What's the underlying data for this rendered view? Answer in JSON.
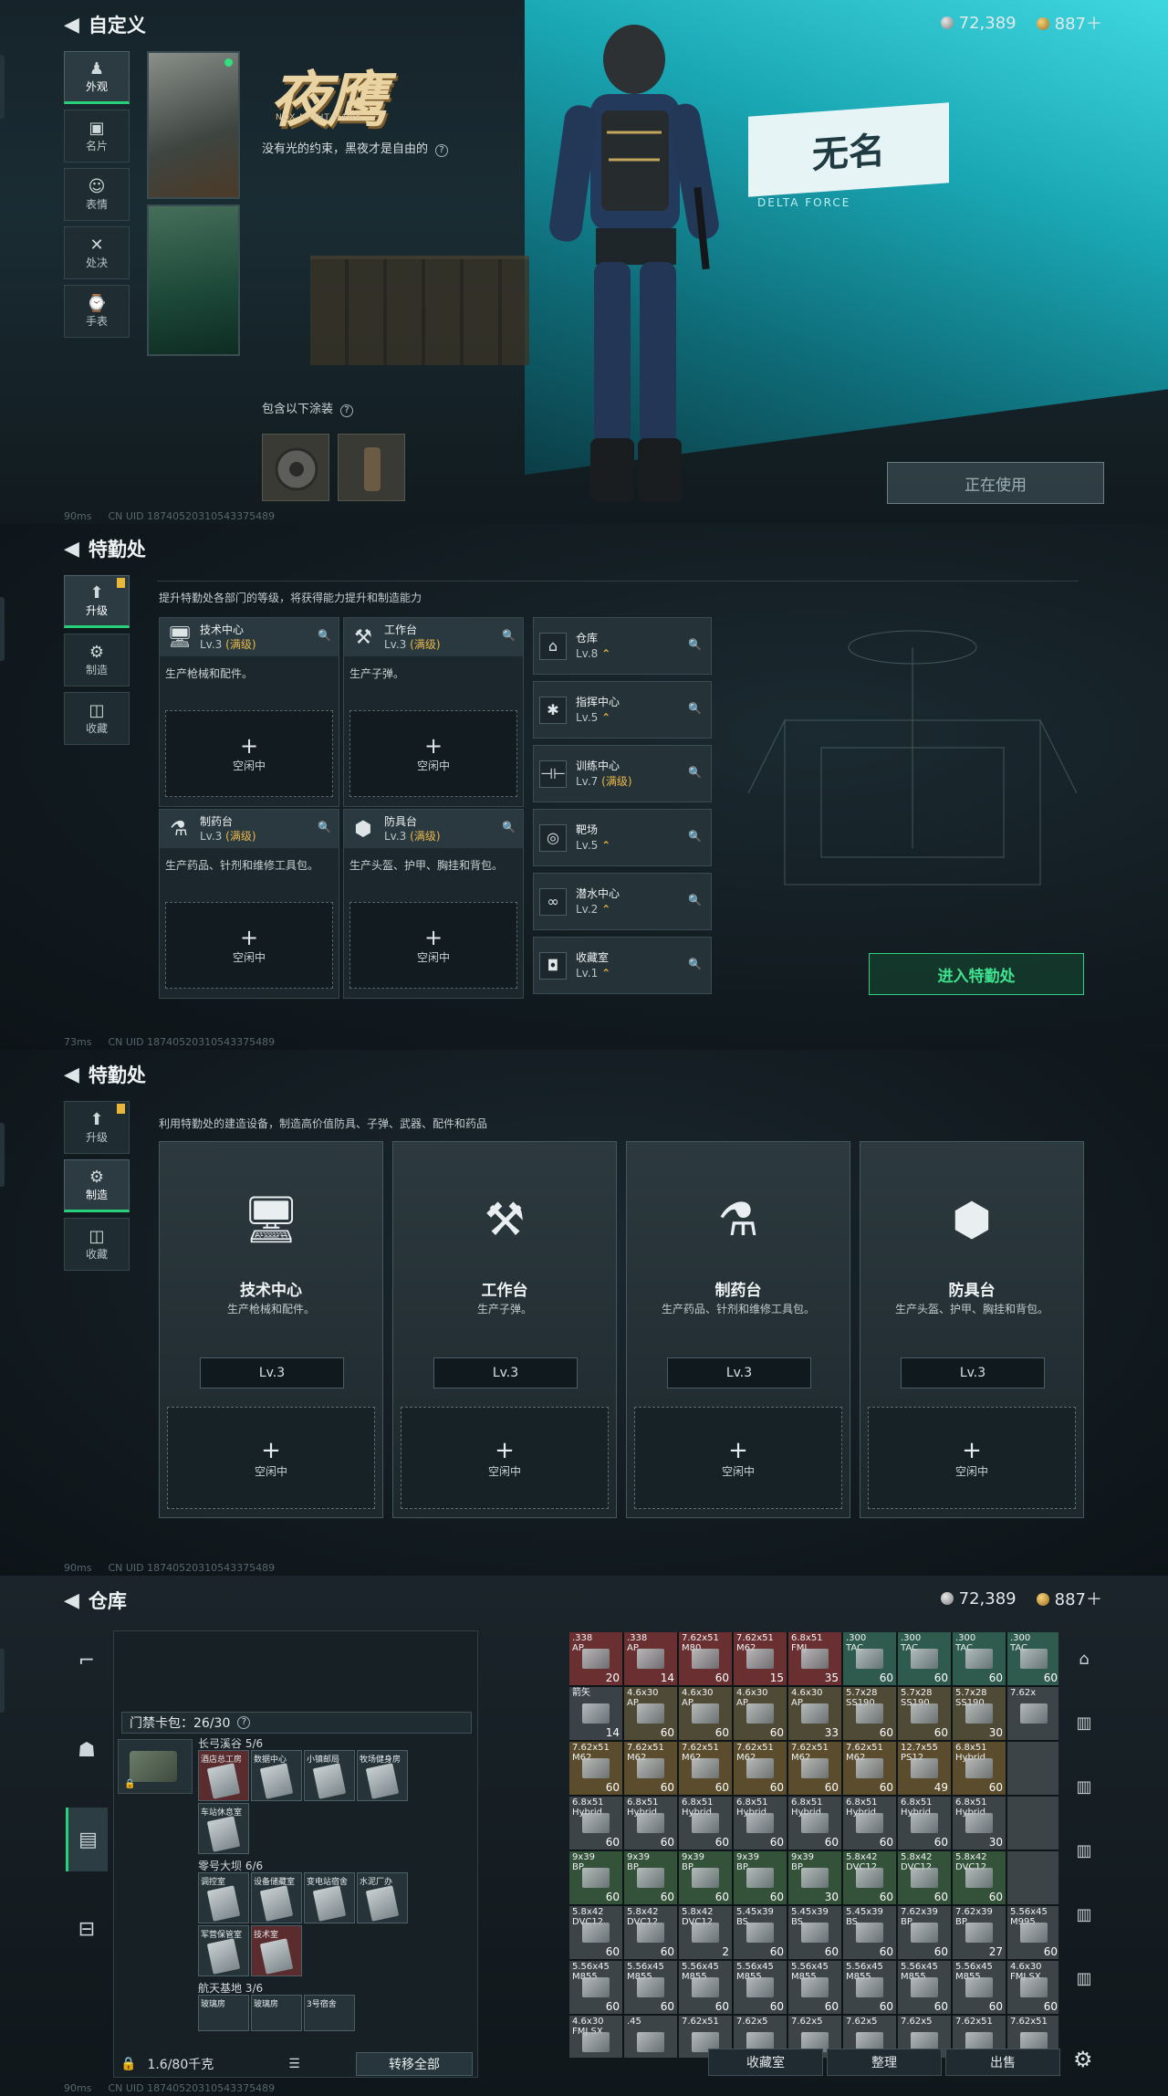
{
  "panel1": {
    "title": "自定义",
    "currency": {
      "silver": "72,389",
      "gold": "887＋"
    },
    "tabs": [
      {
        "label": "外观",
        "icon": "jacket-icon",
        "glyph": "♟"
      },
      {
        "label": "名片",
        "icon": "card-icon",
        "glyph": "▣"
      },
      {
        "label": "表情",
        "icon": "emote-icon",
        "glyph": "☺"
      },
      {
        "label": "处决",
        "icon": "execution-icon",
        "glyph": "✕"
      },
      {
        "label": "手表",
        "icon": "watch-icon",
        "glyph": "⌚"
      }
    ],
    "logo_title": "夜鹰",
    "logo_sub": "NOX NIGHT HAWK",
    "tagline": "没有光的约束，黑夜才是自由的",
    "includes_label": "包含以下涂装",
    "board_text": "无名",
    "board_sub": "DELTA FORCE",
    "in_use_button": "正在使用",
    "status": {
      "ping": "90ms",
      "uid": "CN UID 18740520310543375489"
    }
  },
  "panel2": {
    "title": "特勤处",
    "tabs": [
      {
        "label": "升级",
        "icon": "upgrade-icon",
        "glyph": "⬆"
      },
      {
        "label": "制造",
        "icon": "craft-icon",
        "glyph": "⚙"
      },
      {
        "label": "收藏",
        "icon": "collection-icon",
        "glyph": "◫"
      }
    ],
    "description": "提升特勤处各部门的等级，将获得能力提升和制造能力",
    "departments": [
      {
        "name": "技术中心",
        "level": "Lv.3",
        "max": "(满级)",
        "desc": "生产枪械和配件。",
        "icon": "computer-icon",
        "glyph": "🖥",
        "slot_plus": "+",
        "slot_label": "空闲中"
      },
      {
        "name": "工作台",
        "level": "Lv.3",
        "max": "(满级)",
        "desc": "生产子弹。",
        "icon": "tools-icon",
        "glyph": "⚒",
        "slot_plus": "+",
        "slot_label": "空闲中"
      },
      {
        "name": "制药台",
        "level": "Lv.3",
        "max": "(满级)",
        "desc": "生产药品、针剂和维修工具包。",
        "icon": "microscope-icon",
        "glyph": "⚗",
        "slot_plus": "+",
        "slot_label": "空闲中"
      },
      {
        "name": "防具台",
        "level": "Lv.3",
        "max": "(满级)",
        "desc": "生产头盔、护甲、胸挂和背包。",
        "icon": "cubes-icon",
        "glyph": "⬢",
        "slot_plus": "+",
        "slot_label": "空闲中"
      }
    ],
    "side_items": [
      {
        "name": "仓库",
        "level": "Lv.8",
        "arrow": "⌃",
        "max": "",
        "icon": "warehouse-icon",
        "glyph": "⌂"
      },
      {
        "name": "指挥中心",
        "level": "Lv.5",
        "arrow": "⌃",
        "max": "",
        "icon": "command-icon",
        "glyph": "✱"
      },
      {
        "name": "训练中心",
        "level": "Lv.7",
        "arrow": "",
        "max": "(满级)",
        "icon": "dumbbell-icon",
        "glyph": "⊣⊢"
      },
      {
        "name": "靶场",
        "level": "Lv.5",
        "arrow": "⌃",
        "max": "",
        "icon": "target-icon",
        "glyph": "◎"
      },
      {
        "name": "潜水中心",
        "level": "Lv.2",
        "arrow": "⌃",
        "max": "",
        "icon": "goggles-icon",
        "glyph": "∞"
      },
      {
        "name": "收藏室",
        "level": "Lv.1",
        "arrow": "⌃",
        "max": "",
        "icon": "vault-icon",
        "glyph": "◘"
      }
    ],
    "enter_button": "进入特勤处",
    "status": {
      "ping": "73ms",
      "uid": "CN UID 18740520310543375489"
    }
  },
  "panel3": {
    "title": "特勤处",
    "description": "利用特勤处的建造设备，制造高价值防具、子弹、武器、配件和药品",
    "cards": [
      {
        "name": "技术中心",
        "desc": "生产枪械和配件。",
        "level": "Lv.3",
        "icon": "computer-icon",
        "glyph": "🖥",
        "slot_plus": "+",
        "slot_label": "空闲中"
      },
      {
        "name": "工作台",
        "desc": "生产子弹。",
        "level": "Lv.3",
        "icon": "tools-icon",
        "glyph": "⚒",
        "slot_plus": "+",
        "slot_label": "空闲中"
      },
      {
        "name": "制药台",
        "desc": "生产药品、针剂和维修工具包。",
        "level": "Lv.3",
        "icon": "microscope-icon",
        "glyph": "⚗",
        "slot_plus": "+",
        "slot_label": "空闲中"
      },
      {
        "name": "防具台",
        "desc": "生产头盔、护甲、胸挂和背包。",
        "level": "Lv.3",
        "icon": "cubes-icon",
        "glyph": "⬢",
        "slot_plus": "+",
        "slot_label": "空闲中"
      }
    ],
    "status": {
      "ping": "90ms",
      "uid": "CN UID 18740520310543375489"
    }
  },
  "panel4": {
    "title": "仓库",
    "currency": {
      "silver": "72,389",
      "gold": "887＋"
    },
    "card_pack": "门禁卡包：26/30",
    "groups": [
      {
        "name": "长弓溪谷 5/6",
        "cards": [
          "酒店总工房",
          "数据中心",
          "小镇邮局",
          "牧场健身房",
          "车站休息室"
        ]
      },
      {
        "name": "零号大坝 6/6",
        "cards": [
          "调控室",
          "设备储藏室",
          "变电站宿舍",
          "水泥厂办",
          "军营保管室",
          "技术室"
        ]
      },
      {
        "name": "航天基地 3/6",
        "cards": [
          "玻璃房",
          "玻璃房",
          "3号宿舍"
        ]
      }
    ],
    "weight": "1.6/80千克",
    "transfer_button": "转移全部",
    "bottom_buttons": [
      "收藏室",
      "整理",
      "出售"
    ],
    "cells": [
      {
        "t": ".338\nAP",
        "n": "20",
        "c": "#6a2f31"
      },
      {
        "t": ".338\nAP",
        "n": "14",
        "c": "#6a2f31"
      },
      {
        "t": "7.62x51\nM80",
        "n": "60",
        "c": "#6a2f31"
      },
      {
        "t": "7.62x51\nM62",
        "n": "15",
        "c": "#6a2f31"
      },
      {
        "t": "6.8x51\nFMJ",
        "n": "35",
        "c": "#6a2f31"
      },
      {
        "t": ".300\nTAC",
        "n": "60",
        "c": "#2f5a4e"
      },
      {
        "t": ".300\nTAC",
        "n": "60",
        "c": "#2f5a4e"
      },
      {
        "t": ".300\nTAC",
        "n": "60",
        "c": "#2f5a4e"
      },
      {
        "t": ".300\nTAC",
        "n": "60",
        "c": "#2f5a4e"
      },
      {
        "t": "箭矢\n",
        "n": "14",
        "c": "#3b4247"
      },
      {
        "t": "4.6x30\nAP",
        "n": "60",
        "c": "#4f4a36"
      },
      {
        "t": "4.6x30\nAP",
        "n": "60",
        "c": "#4f4a36"
      },
      {
        "t": "4.6x30\nAP",
        "n": "60",
        "c": "#4f4a36"
      },
      {
        "t": "4.6x30\nAP",
        "n": "33",
        "c": "#4f4a36"
      },
      {
        "t": "5.7x28\nSS190",
        "n": "60",
        "c": "#4f4a36"
      },
      {
        "t": "5.7x28\nSS190",
        "n": "60",
        "c": "#4f4a36"
      },
      {
        "t": "5.7x28\nSS190",
        "n": "30",
        "c": "#4f4a36"
      },
      {
        "t": "7.62x\n",
        "n": "",
        "c": "#3d4448"
      },
      {
        "t": "7.62x51\nM62",
        "n": "60",
        "c": "#5a4c2c"
      },
      {
        "t": "7.62x51\nM62",
        "n": "60",
        "c": "#5a4c2c"
      },
      {
        "t": "7.62x51\nM62",
        "n": "60",
        "c": "#5a4c2c"
      },
      {
        "t": "7.62x51\nM62",
        "n": "60",
        "c": "#5a4c2c"
      },
      {
        "t": "7.62x51\nM62",
        "n": "60",
        "c": "#5a4c2c"
      },
      {
        "t": "7.62x51\nM62",
        "n": "60",
        "c": "#5a4c2c"
      },
      {
        "t": "12.7x55\nPS12",
        "n": "49",
        "c": "#5a4c2c"
      },
      {
        "t": "6.8x51\nHybrid",
        "n": "60",
        "c": "#5a4c2c"
      },
      {
        "t": "",
        "n": "",
        "c": "#3d4448"
      },
      {
        "t": "6.8x51\nHybrid",
        "n": "60",
        "c": "#3d4448"
      },
      {
        "t": "6.8x51\nHybrid",
        "n": "60",
        "c": "#3d4448"
      },
      {
        "t": "6.8x51\nHybrid",
        "n": "60",
        "c": "#3d4448"
      },
      {
        "t": "6.8x51\nHybrid",
        "n": "60",
        "c": "#3d4448"
      },
      {
        "t": "6.8x51\nHybrid",
        "n": "60",
        "c": "#3d4448"
      },
      {
        "t": "6.8x51\nHybrid",
        "n": "60",
        "c": "#3d4448"
      },
      {
        "t": "6.8x51\nHybrid",
        "n": "60",
        "c": "#3d4448"
      },
      {
        "t": "6.8x51\nHybrid",
        "n": "30",
        "c": "#3d4448"
      },
      {
        "t": "",
        "n": "",
        "c": "#3d4448"
      },
      {
        "t": "9x39\nBP",
        "n": "60",
        "c": "#34513a"
      },
      {
        "t": "9x39\nBP",
        "n": "60",
        "c": "#34513a"
      },
      {
        "t": "9x39\nBP",
        "n": "60",
        "c": "#34513a"
      },
      {
        "t": "9x39\nBP",
        "n": "60",
        "c": "#34513a"
      },
      {
        "t": "9x39\nBP",
        "n": "30",
        "c": "#34513a"
      },
      {
        "t": "5.8x42\nDVC12",
        "n": "60",
        "c": "#34513a"
      },
      {
        "t": "5.8x42\nDVC12",
        "n": "60",
        "c": "#34513a"
      },
      {
        "t": "5.8x42\nDVC12",
        "n": "60",
        "c": "#34513a"
      },
      {
        "t": "",
        "n": "",
        "c": "#3d4448"
      },
      {
        "t": "5.8x42\nDVC12",
        "n": "60",
        "c": "#3d4448"
      },
      {
        "t": "5.8x42\nDVC12",
        "n": "60",
        "c": "#3d4448"
      },
      {
        "t": "5.8x42\nDVC12",
        "n": "2",
        "c": "#3d4448"
      },
      {
        "t": "5.45x39\nBS",
        "n": "60",
        "c": "#3d4448"
      },
      {
        "t": "5.45x39\nBS",
        "n": "60",
        "c": "#3d4448"
      },
      {
        "t": "5.45x39\nBS",
        "n": "60",
        "c": "#3d4448"
      },
      {
        "t": "7.62x39\nBP",
        "n": "60",
        "c": "#3d4448"
      },
      {
        "t": "7.62x39\nBP",
        "n": "27",
        "c": "#3d4448"
      },
      {
        "t": "5.56x45\nM995",
        "n": "60",
        "c": "#3d4448"
      },
      {
        "t": "5.56x45\nM855",
        "n": "60",
        "c": "#3d4448"
      },
      {
        "t": "5.56x45\nM855",
        "n": "60",
        "c": "#3d4448"
      },
      {
        "t": "5.56x45\nM855",
        "n": "60",
        "c": "#3d4448"
      },
      {
        "t": "5.56x45\nM855",
        "n": "60",
        "c": "#3d4448"
      },
      {
        "t": "5.56x45\nM855",
        "n": "60",
        "c": "#3d4448"
      },
      {
        "t": "5.56x45\nM855",
        "n": "60",
        "c": "#3d4448"
      },
      {
        "t": "5.56x45\nM855",
        "n": "60",
        "c": "#3d4448"
      },
      {
        "t": "5.56x45\nM855",
        "n": "60",
        "c": "#3d4448"
      },
      {
        "t": "4.6x30\nFMJ SX",
        "n": "60",
        "c": "#3d4448"
      },
      {
        "t": "4.6x30\nFMJ SX",
        "n": "",
        "c": "#3d4448"
      },
      {
        "t": ".45\n",
        "n": "",
        "c": "#3d4448"
      },
      {
        "t": "7.62x51\n",
        "n": "",
        "c": "#3d4448"
      },
      {
        "t": "7.62x5\n",
        "n": "",
        "c": "#3d4448"
      },
      {
        "t": "7.62x5\n",
        "n": "",
        "c": "#3d4448"
      },
      {
        "t": "7.62x5\n",
        "n": "",
        "c": "#3d4448"
      },
      {
        "t": "7.62x5\n",
        "n": "",
        "c": "#3d4448"
      },
      {
        "t": "7.62x51\n",
        "n": "",
        "c": "#3d4448"
      },
      {
        "t": "7.62x51\n",
        "n": "",
        "c": "#3d4448"
      }
    ],
    "status": {
      "ping": "90ms",
      "uid": "CN UID 18740520310543375489"
    }
  }
}
